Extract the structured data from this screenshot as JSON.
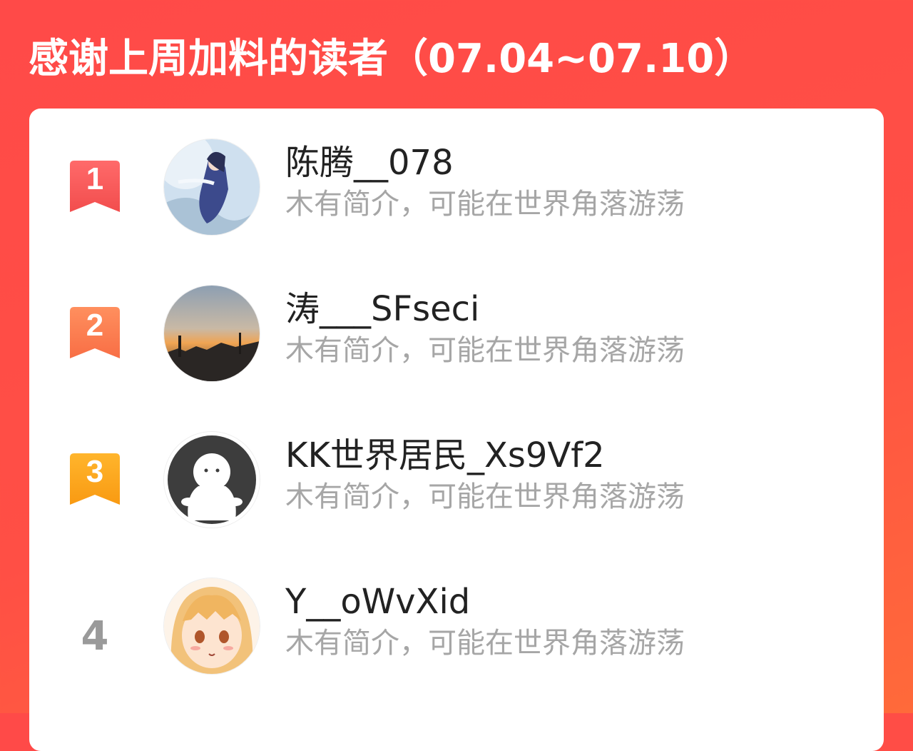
{
  "header": {
    "title": "感谢上周加料的读者（07.04~07.10）"
  },
  "leaderboard": {
    "items": [
      {
        "rank": "1",
        "name": "陈腾__078",
        "bio": "木有简介，可能在世界角落游荡",
        "badge_color": "#f55a5a",
        "avatar": "anime-warrior-avatar"
      },
      {
        "rank": "2",
        "name": "涛___SFseci",
        "bio": "木有简介，可能在世界角落游荡",
        "badge_color": "#fb7b4e",
        "avatar": "sunset-photo-avatar"
      },
      {
        "rank": "3",
        "name": "KK世界居民_Xs9Vf2",
        "bio": "木有简介，可能在世界角落游荡",
        "badge_color": "#fca31c",
        "avatar": "default-ghost-avatar"
      },
      {
        "rank": "4",
        "name": "Y__oWvXid",
        "bio": "木有简介，可能在世界角落游荡",
        "badge_color": "",
        "avatar": "anime-girl-avatar"
      }
    ]
  },
  "colors": {
    "background": "#ff4a48",
    "card": "#ffffff",
    "name_text": "#222222",
    "bio_text": "#a6a6a6",
    "rank_plain": "#9a9a9a"
  }
}
